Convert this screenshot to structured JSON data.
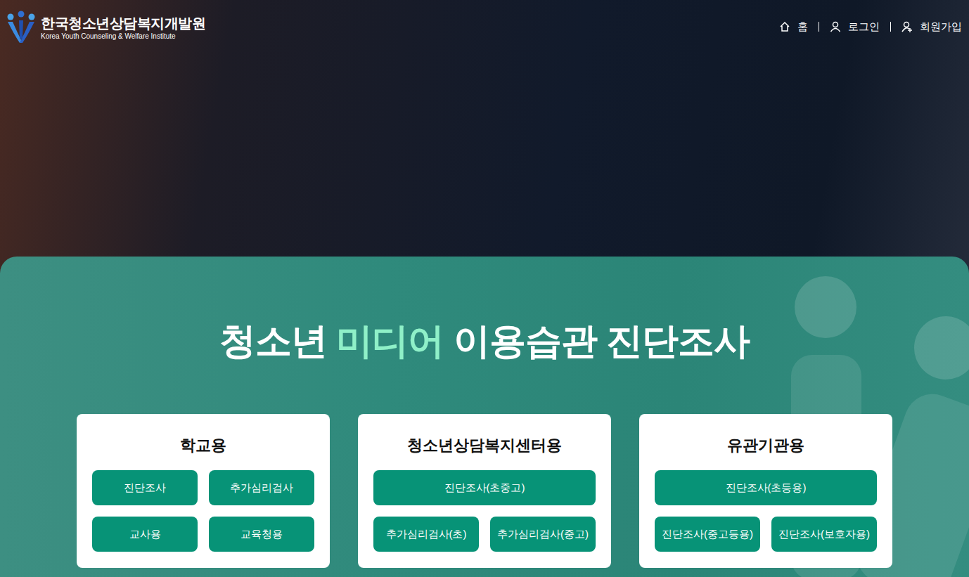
{
  "header": {
    "logo": {
      "name": "한국청소년상담복지개발원",
      "subtitle": "Korea Youth Counseling & Welfare Institute"
    },
    "nav": [
      {
        "label": "홈"
      },
      {
        "label": "로그인"
      },
      {
        "label": "회원가입"
      }
    ]
  },
  "hero": {
    "title": [
      {
        "text": "청소년 ",
        "highlight": false
      },
      {
        "text": "미디어",
        "highlight": true
      },
      {
        "text": " 이용습관 진단조사",
        "highlight": false
      }
    ]
  },
  "cards": [
    {
      "title": "학교용",
      "rows": [
        [
          "진단조사",
          "추가심리검사"
        ],
        [
          "교사용",
          "교육청용"
        ]
      ]
    },
    {
      "title": "청소년상담복지센터용",
      "rows": [
        [
          "진단조사(초중고)"
        ],
        [
          "추가심리검사(초)",
          "추가심리검사(중고)"
        ]
      ]
    },
    {
      "title": "유관기관용",
      "rows": [
        [
          "진단조사(초등용)"
        ],
        [
          "진단조사(중고등용)",
          "진단조사(보호자용)"
        ]
      ]
    }
  ]
}
